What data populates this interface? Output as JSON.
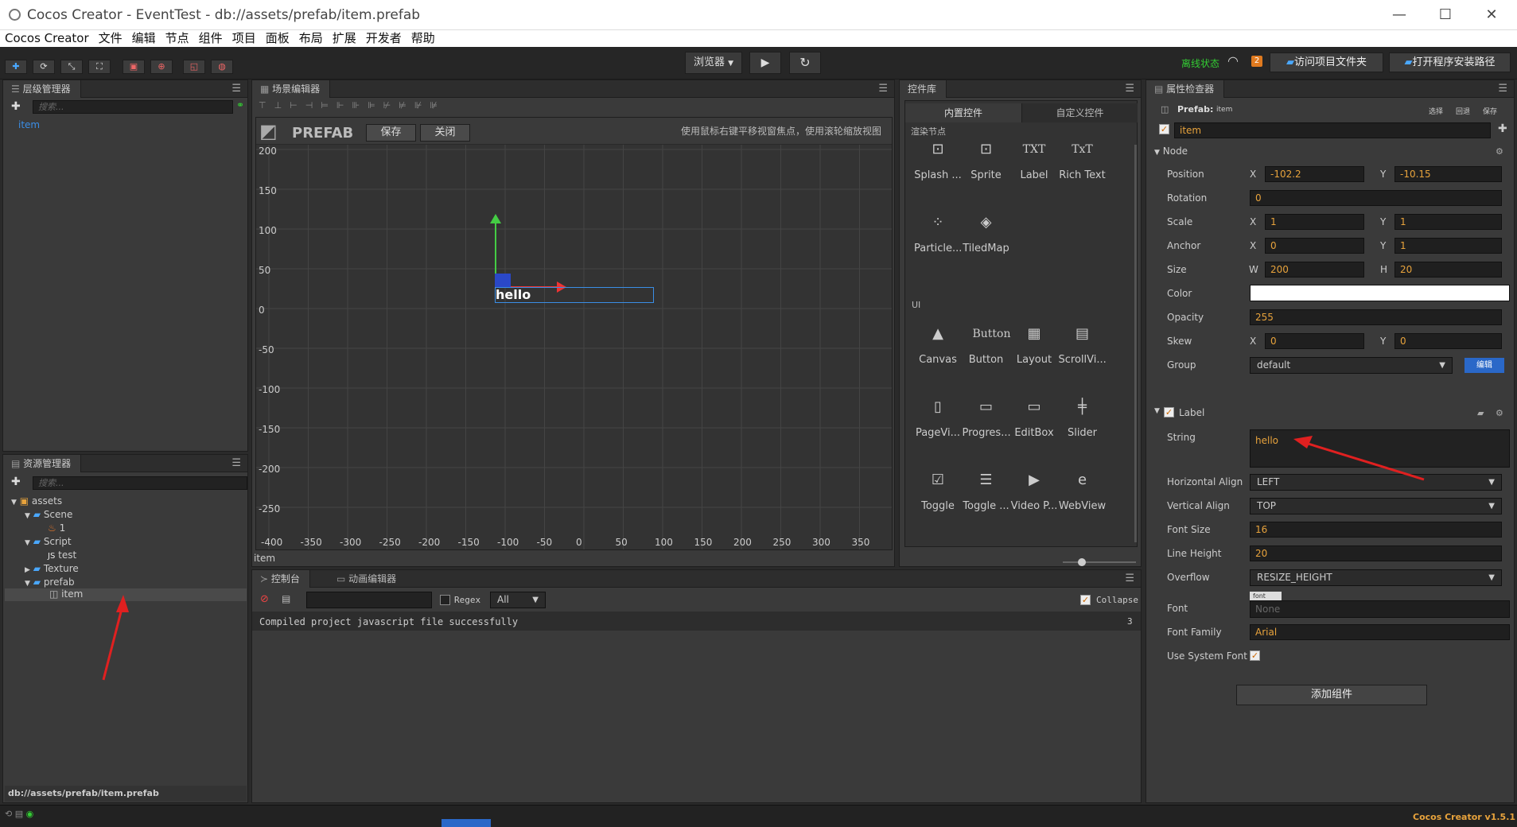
{
  "window": {
    "title": "Cocos Creator - EventTest - db://assets/prefab/item.prefab",
    "min": "—",
    "max": "☐",
    "close": "✕"
  },
  "menu": [
    "Cocos Creator",
    "文件",
    "编辑",
    "节点",
    "组件",
    "项目",
    "面板",
    "布局",
    "扩展",
    "开发者",
    "帮助"
  ],
  "toolbar": {
    "browser_label": "浏览器",
    "offline": "离线状态",
    "badge": "2",
    "open_project": "访问项目文件夹",
    "open_install": "打开程序安装路径"
  },
  "hierarchy": {
    "title": "层级管理器",
    "search_placeholder": "搜索...",
    "item": "item"
  },
  "assets": {
    "title": "资源管理器",
    "search_placeholder": "搜索...",
    "tree": [
      {
        "label": "assets"
      },
      {
        "label": "Scene"
      },
      {
        "label": "1"
      },
      {
        "label": "Script"
      },
      {
        "label": "test"
      },
      {
        "label": "Texture"
      },
      {
        "label": "prefab"
      },
      {
        "label": "item"
      }
    ],
    "path": "db://assets/prefab/item.prefab"
  },
  "scene": {
    "title": "场景编辑器",
    "prefab_label": "PREFAB",
    "save": "保存",
    "close": "关闭",
    "hint": "使用鼠标右键平移视窗焦点，使用滚轮缩放视图",
    "y_ticks": [
      "200",
      "150",
      "100",
      "50",
      "0",
      "-50",
      "-100",
      "-150",
      "-200",
      "-250"
    ],
    "x_ticks": [
      "-400",
      "-350",
      "-300",
      "-250",
      "-200",
      "-150",
      "-100",
      "-50",
      "0",
      "50",
      "100",
      "150",
      "200",
      "250",
      "300",
      "350"
    ],
    "node_text": "hello",
    "status": "item"
  },
  "library": {
    "title": "控件库",
    "tab_builtin": "内置控件",
    "tab_custom": "自定义控件",
    "section_render": "渲染节点",
    "section_ui": "UI",
    "render_items": [
      {
        "label": "Splash ...",
        "icon": "splash-icon",
        "glyph": "⊡"
      },
      {
        "label": "Sprite",
        "icon": "sprite-icon",
        "glyph": "⊡"
      },
      {
        "label": "Label",
        "icon": "label-icon",
        "glyph": "TXT"
      },
      {
        "label": "Rich Text",
        "icon": "richtext-icon",
        "glyph": "TxT"
      },
      {
        "label": "Particle...",
        "icon": "particle-icon",
        "glyph": "⁘"
      },
      {
        "label": "TiledMap",
        "icon": "tiledmap-icon",
        "glyph": "◈"
      }
    ],
    "ui_items": [
      {
        "label": "Canvas",
        "icon": "canvas-icon",
        "glyph": "▲"
      },
      {
        "label": "Button",
        "icon": "button-icon",
        "glyph": "Button"
      },
      {
        "label": "Layout",
        "icon": "layout-icon",
        "glyph": "▦"
      },
      {
        "label": "ScrollVi...",
        "icon": "scrollview-icon",
        "glyph": "▤"
      },
      {
        "label": "PageVi...",
        "icon": "pageview-icon",
        "glyph": "▯"
      },
      {
        "label": "Progres...",
        "icon": "progressbar-icon",
        "glyph": "▭"
      },
      {
        "label": "EditBox",
        "icon": "editbox-icon",
        "glyph": "▭"
      },
      {
        "label": "Slider",
        "icon": "slider-icon",
        "glyph": "╪"
      },
      {
        "label": "Toggle",
        "icon": "toggle-icon",
        "glyph": "☑"
      },
      {
        "label": "Toggle ...",
        "icon": "togglegroup-icon",
        "glyph": "☰"
      },
      {
        "label": "Video P...",
        "icon": "videoplayer-icon",
        "glyph": "▶"
      },
      {
        "label": "WebView",
        "icon": "webview-icon",
        "glyph": "e"
      }
    ]
  },
  "console": {
    "tab_console": "控制台",
    "tab_animation": "动画编辑器",
    "regex": "Regex",
    "filter": "All",
    "collapse": "Collapse",
    "log": "Compiled project javascript file successfully",
    "log_count": "3"
  },
  "inspector": {
    "title": "属性检查器",
    "prefab_label": "Prefab:",
    "prefab_name": "item",
    "actions": [
      "选择",
      "回退",
      "保存"
    ],
    "node_name": "item",
    "node_section": "Node",
    "position_label": "Position",
    "position_x": "-102.2",
    "position_y": "-10.15",
    "rotation_label": "Rotation",
    "rotation": "0",
    "scale_label": "Scale",
    "scale_x": "1",
    "scale_y": "1",
    "anchor_label": "Anchor",
    "anchor_x": "0",
    "anchor_y": "1",
    "size_label": "Size",
    "size_w": "200",
    "size_h": "20",
    "color_label": "Color",
    "opacity_label": "Opacity",
    "opacity": "255",
    "skew_label": "Skew",
    "skew_x": "0",
    "skew_y": "0",
    "group_label": "Group",
    "group": "default",
    "group_edit": "编辑",
    "label_section": "Label",
    "string_label": "String",
    "string": "hello",
    "halign_label": "Horizontal Align",
    "halign": "LEFT",
    "valign_label": "Vertical Align",
    "valign": "TOP",
    "fontsize_label": "Font Size",
    "fontsize": "16",
    "lineheight_label": "Line Height",
    "lineheight": "20",
    "overflow_label": "Overflow",
    "overflow": "RESIZE_HEIGHT",
    "font_label": "Font",
    "font_tag": "font",
    "font_value": "None",
    "fontfamily_label": "Font Family",
    "fontfamily": "Arial",
    "usesystem_label": "Use System Font",
    "add_component": "添加组件",
    "xl": "X",
    "yl": "Y",
    "wl": "W",
    "hl": "H"
  },
  "statusbar": {
    "version": "Cocos Creator v1.5.1"
  },
  "colors": {
    "accent": "#e8a33c",
    "selection": "#2a68c8",
    "annotation": "#e02020"
  }
}
